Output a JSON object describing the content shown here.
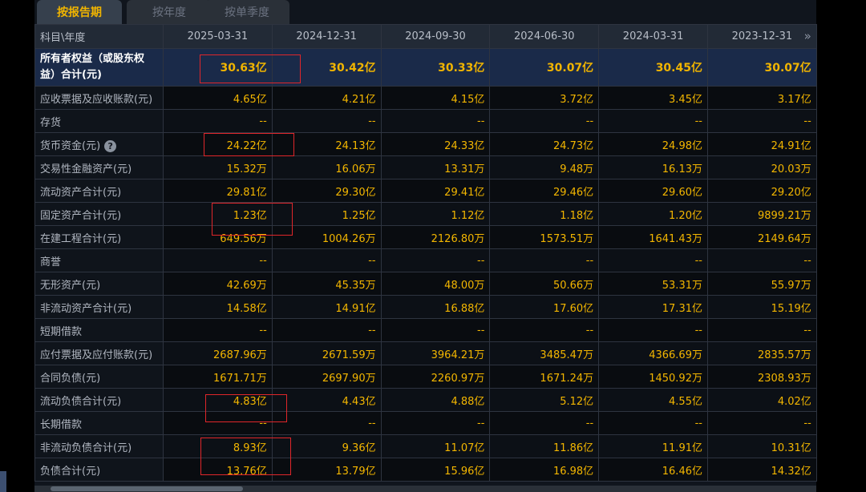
{
  "tabs": [
    {
      "label": "按报告期",
      "active": true
    },
    {
      "label": "按年度",
      "active": false
    },
    {
      "label": "按单季度",
      "active": false
    }
  ],
  "header": {
    "corner_label": "科目\\年度",
    "dates": [
      "2025-03-31",
      "2024-12-31",
      "2024-09-30",
      "2024-06-30",
      "2024-03-31",
      "2023-12-31"
    ],
    "more_icon": "double-chevron-right-icon"
  },
  "rows": [
    {
      "label": "所有者权益（或股东权益）合计(元)",
      "values": [
        "30.63亿",
        "30.42亿",
        "30.33亿",
        "30.07亿",
        "30.45亿",
        "30.07亿"
      ]
    },
    {
      "label": "应收票据及应收账款(元)",
      "values": [
        "4.65亿",
        "4.21亿",
        "4.15亿",
        "3.72亿",
        "3.45亿",
        "3.17亿"
      ]
    },
    {
      "label": "存货",
      "values": [
        "--",
        "--",
        "--",
        "--",
        "--",
        "--"
      ]
    },
    {
      "label": "货币资金(元)",
      "help": "?",
      "values": [
        "24.22亿",
        "24.13亿",
        "24.33亿",
        "24.73亿",
        "24.98亿",
        "24.91亿"
      ]
    },
    {
      "label": "交易性金融资产(元)",
      "values": [
        "15.32万",
        "16.06万",
        "13.31万",
        "9.48万",
        "16.13万",
        "20.03万"
      ]
    },
    {
      "label": "流动资产合计(元)",
      "values": [
        "29.81亿",
        "29.30亿",
        "29.41亿",
        "29.46亿",
        "29.60亿",
        "29.20亿"
      ]
    },
    {
      "label": "固定资产合计(元)",
      "values": [
        "1.23亿",
        "1.25亿",
        "1.12亿",
        "1.18亿",
        "1.20亿",
        "9899.21万"
      ]
    },
    {
      "label": "在建工程合计(元)",
      "values": [
        "649.56万",
        "1004.26万",
        "2126.80万",
        "1573.51万",
        "1641.43万",
        "2149.64万"
      ]
    },
    {
      "label": "商誉",
      "values": [
        "--",
        "--",
        "--",
        "--",
        "--",
        "--"
      ]
    },
    {
      "label": "无形资产(元)",
      "values": [
        "42.69万",
        "45.35万",
        "48.00万",
        "50.66万",
        "53.31万",
        "55.97万"
      ]
    },
    {
      "label": "非流动资产合计(元)",
      "values": [
        "14.58亿",
        "14.91亿",
        "16.88亿",
        "17.60亿",
        "17.31亿",
        "15.19亿"
      ]
    },
    {
      "label": "短期借款",
      "values": [
        "--",
        "--",
        "--",
        "--",
        "--",
        "--"
      ]
    },
    {
      "label": "应付票据及应付账款(元)",
      "values": [
        "2687.96万",
        "2671.59万",
        "3964.21万",
        "3485.47万",
        "4366.69万",
        "2835.57万"
      ]
    },
    {
      "label": "合同负债(元)",
      "values": [
        "1671.71万",
        "2697.90万",
        "2260.97万",
        "1671.24万",
        "1450.92万",
        "2308.93万"
      ]
    },
    {
      "label": "流动负债合计(元)",
      "values": [
        "4.83亿",
        "4.43亿",
        "4.88亿",
        "5.12亿",
        "4.55亿",
        "4.02亿"
      ]
    },
    {
      "label": "长期借款",
      "values": [
        "--",
        "--",
        "--",
        "--",
        "--",
        "--"
      ]
    },
    {
      "label": "非流动负债合计(元)",
      "values": [
        "8.93亿",
        "9.36亿",
        "11.07亿",
        "11.86亿",
        "11.91亿",
        "10.31亿"
      ]
    },
    {
      "label": "负债合计(元)",
      "values": [
        "13.76亿",
        "13.79亿",
        "15.96亿",
        "16.98亿",
        "16.46亿",
        "14.32亿"
      ]
    }
  ],
  "highlight_color": "#e0262a"
}
